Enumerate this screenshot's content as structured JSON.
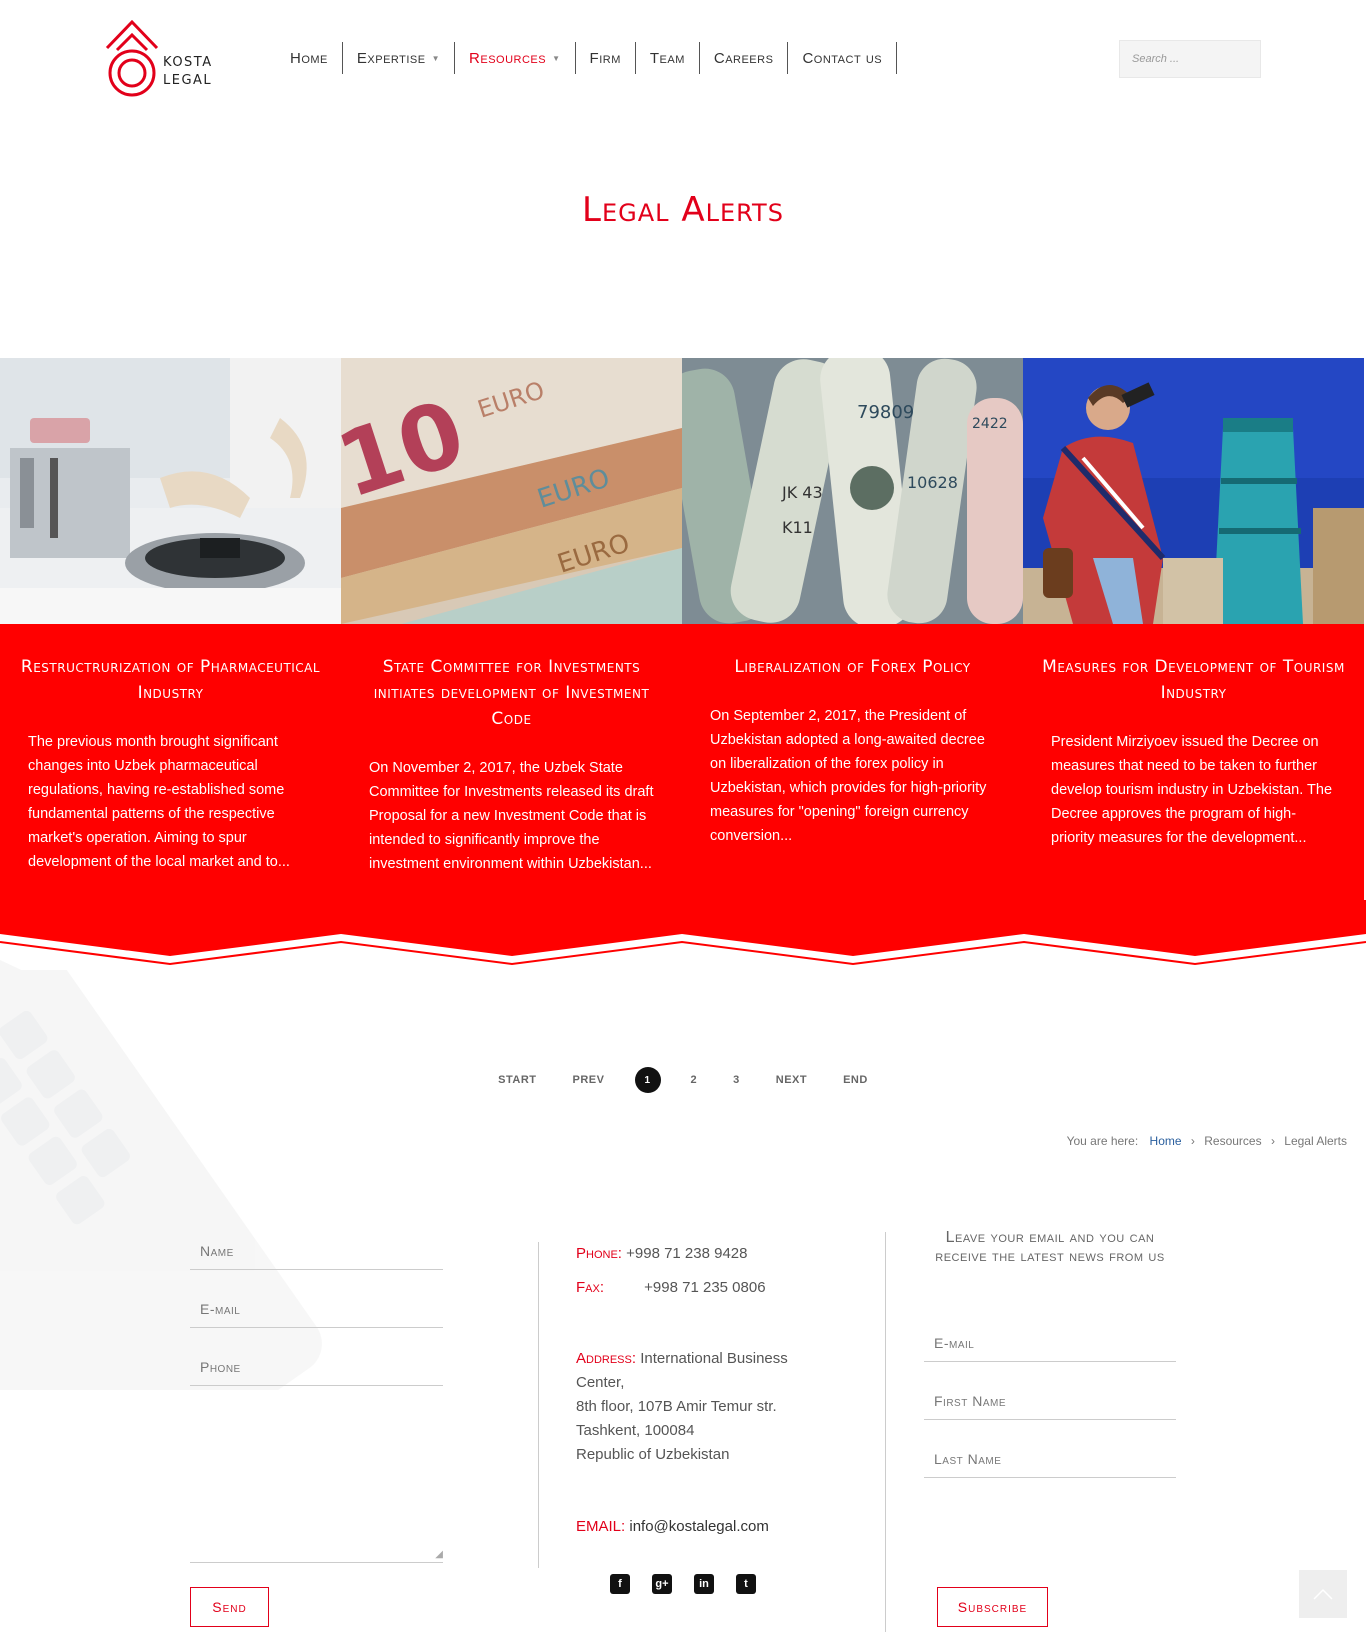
{
  "brand": {
    "line1": "KOSTA",
    "line2": "LEGAL"
  },
  "nav": {
    "home": "Home",
    "expertise": "Expertise",
    "resources": "Resources",
    "firm": "Firm",
    "team": "Team",
    "careers": "Careers",
    "contact": "Contact us"
  },
  "search": {
    "placeholder": "Search ..."
  },
  "page_title": "Legal Alerts",
  "accent_color": "#ff0000",
  "cards": [
    {
      "title": "Restructrurization of Pharmaceutical Industry",
      "text": "The previous month brought significant changes into Uzbek pharmaceutical regulations, having re-established some fundamental patterns of the respective market's operation. Aiming to spur development of the local market and to..."
    },
    {
      "title": "State Committee for Investments initiates development of Investment Code",
      "text": "On November 2, 2017, the Uzbek State Committee for Investments released its draft Proposal for a new Investment Code that is intended to significantly improve the investment environment within Uzbekistan..."
    },
    {
      "title": "Liberalization of Forex Policy",
      "text": "On September 2, 2017, the President of Uzbekistan adopted a long-awaited decree on liberalization of the forex policy in Uzbekistan, which provides for high-priority measures for \"opening\" foreign currency conversion..."
    },
    {
      "title": "Measures for Development of Tourism Industry",
      "text": "President Mirziyoev issued the Decree on measures that need to be taken to further develop tourism industry in Uzbekistan. The Decree approves the program of high-priority measures for the development..."
    }
  ],
  "pagination": {
    "start": "START",
    "prev": "PREV",
    "p1": "1",
    "p2": "2",
    "p3": "3",
    "next": "NEXT",
    "end": "END"
  },
  "breadcrumb": {
    "prefix": "You are here:",
    "home": "Home",
    "resources": "Resources",
    "current": "Legal Alerts"
  },
  "contact_form": {
    "name": "Name",
    "email": "E-mail",
    "phone": "Phone",
    "send": "Send"
  },
  "contact_info": {
    "phone_label": "Phone:",
    "phone": "+998 71 238 9428",
    "fax_label": "Fax:",
    "fax": "+998 71 235 0806",
    "address_label": "Address:",
    "address_1": "International Business Center,",
    "address_2": "8th floor, 107B Amir Temur str.",
    "address_3": "Tashkent, 100084",
    "address_4": "Republic of Uzbekistan",
    "email_label": "EMAIL:",
    "email": "info@kostalegal.com"
  },
  "social": {
    "facebook": "f",
    "google": "g+",
    "linkedin": "in",
    "twitter": "t"
  },
  "newsletter": {
    "title": "Leave your email and you can receive the latest news from us",
    "email": "E-mail",
    "first_name": "First Name",
    "last_name": "Last Name",
    "subscribe": "Subscribe"
  }
}
